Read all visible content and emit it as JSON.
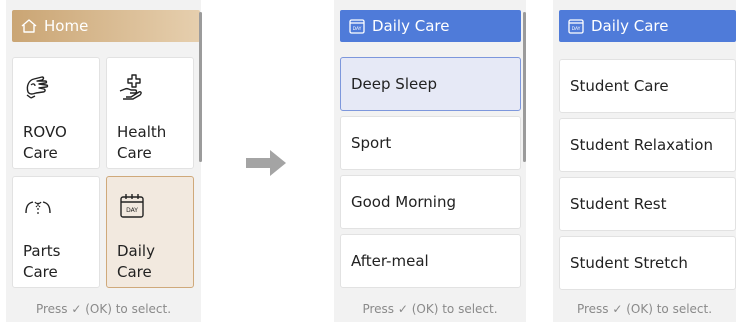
{
  "home_panel": {
    "title": "Home",
    "icon": "home-icon",
    "tiles": [
      {
        "label": "ROVO\nCare",
        "icon": "massage-hand-icon",
        "selected": false
      },
      {
        "label": "Health\nCare",
        "icon": "hand-plus-icon",
        "selected": false
      },
      {
        "label": "Parts\nCare",
        "icon": "body-parts-icon",
        "selected": false
      },
      {
        "label": "Daily\nCare",
        "icon": "calendar-day-icon",
        "selected": true
      }
    ],
    "hint": "Press ✓ (OK) to select."
  },
  "daily_panel": {
    "title": "Daily Care",
    "icon": "calendar-day-icon",
    "items": [
      {
        "label": "Deep Sleep",
        "selected": true
      },
      {
        "label": "Sport",
        "selected": false
      },
      {
        "label": "Good Morning",
        "selected": false
      },
      {
        "label": "After-meal",
        "selected": false
      }
    ],
    "hint": "Press ✓ (OK) to select."
  },
  "student_panel": {
    "title": "Daily Care",
    "icon": "calendar-day-icon",
    "items": [
      {
        "label": "Student Care"
      },
      {
        "label": "Student Relaxation"
      },
      {
        "label": "Student Rest"
      },
      {
        "label": "Student Stretch"
      }
    ],
    "hint": "Press ✓ (OK) to select."
  },
  "arrow_icon": "arrow-right-icon",
  "colors": {
    "home_accent": "#caa574",
    "daily_accent": "#4f7bd9",
    "selected_tile": "#f2e9df",
    "selected_row": "#e6e9f6"
  }
}
